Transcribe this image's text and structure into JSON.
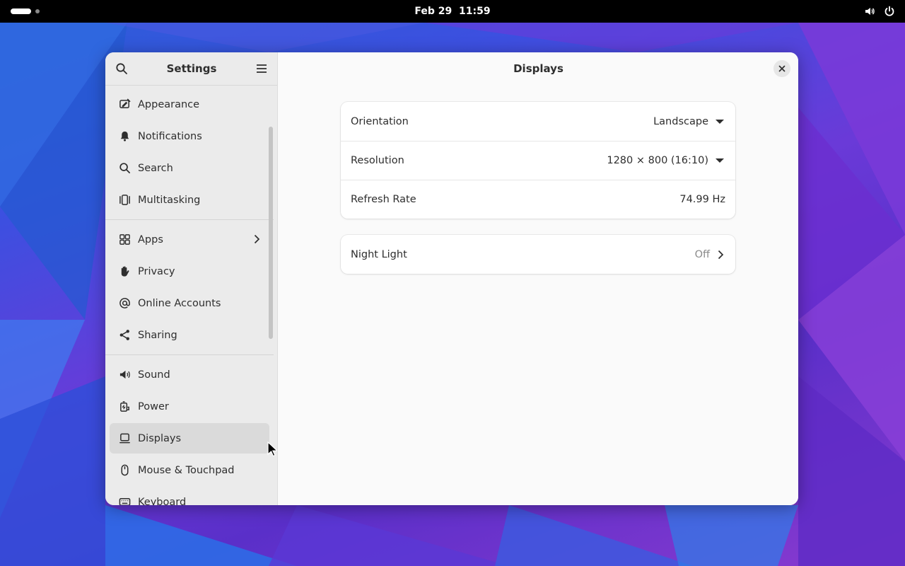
{
  "topbar": {
    "date": "Feb 29",
    "time": "11:59",
    "icons": [
      "volume-icon",
      "power-icon"
    ]
  },
  "sidebar": {
    "title": "Settings",
    "groups": [
      [
        {
          "label": "Appearance",
          "icon": "appearance-icon"
        },
        {
          "label": "Notifications",
          "icon": "bell-icon"
        },
        {
          "label": "Search",
          "icon": "search-icon"
        },
        {
          "label": "Multitasking",
          "icon": "multitasking-icon"
        }
      ],
      [
        {
          "label": "Apps",
          "icon": "apps-grid-icon",
          "has_submenu": true
        },
        {
          "label": "Privacy",
          "icon": "hand-icon"
        },
        {
          "label": "Online Accounts",
          "icon": "at-sign-icon"
        },
        {
          "label": "Sharing",
          "icon": "share-icon"
        }
      ],
      [
        {
          "label": "Sound",
          "icon": "speaker-icon"
        },
        {
          "label": "Power",
          "icon": "power-plug-icon"
        },
        {
          "label": "Displays",
          "icon": "display-icon",
          "active": true
        },
        {
          "label": "Mouse & Touchpad",
          "icon": "mouse-icon"
        },
        {
          "label": "Keyboard",
          "icon": "keyboard-icon"
        }
      ]
    ]
  },
  "content": {
    "title": "Displays",
    "display_settings": {
      "orientation": {
        "label": "Orientation",
        "value": "Landscape"
      },
      "resolution": {
        "label": "Resolution",
        "value": "1280 × 800 (16:10)"
      },
      "refresh_rate": {
        "label": "Refresh Rate",
        "value": "74.99 Hz"
      }
    },
    "night_light": {
      "label": "Night Light",
      "value": "Off"
    }
  },
  "colors": {
    "accent": "#3584e4",
    "window_bg": "#fafafa",
    "sidebar_bg": "#ebebeb",
    "active_item": "#dadada"
  }
}
